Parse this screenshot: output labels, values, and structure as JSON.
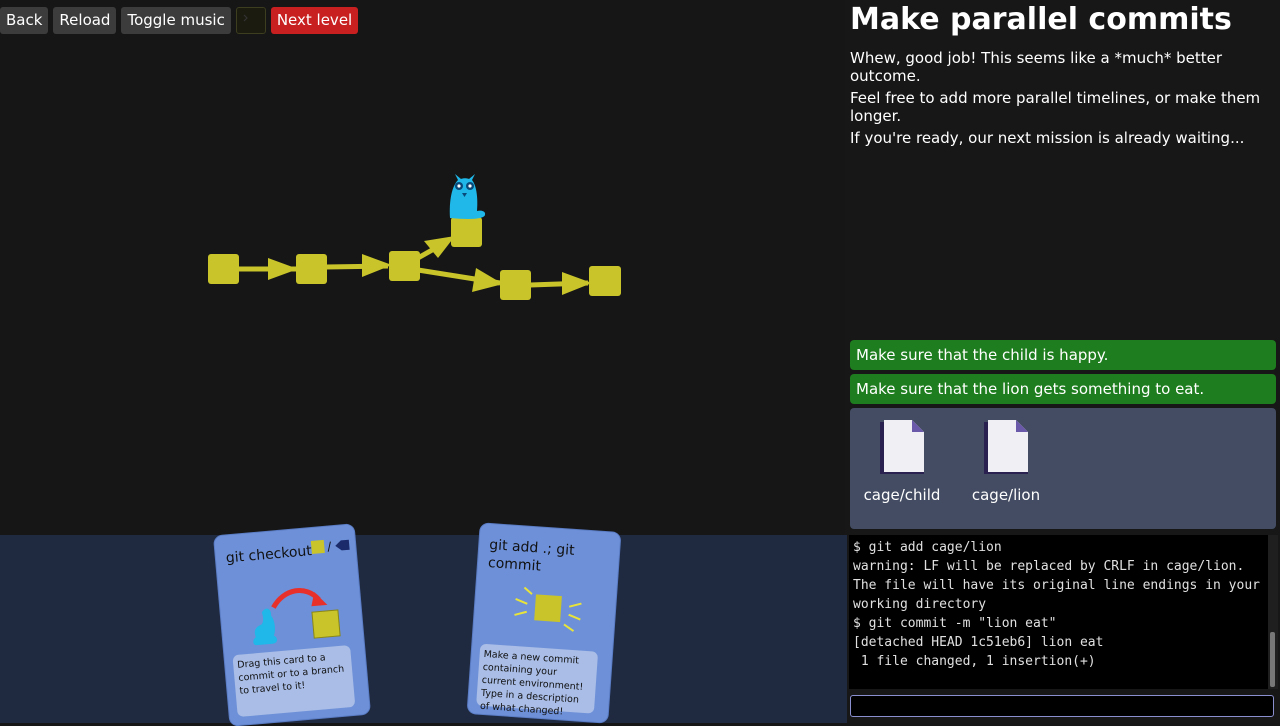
{
  "toolbar": {
    "back_label": "Back",
    "reload_label": "Reload",
    "toggle_music_label": "Toggle music",
    "next_level_label": "Next level",
    "next_level_color": "#c82020"
  },
  "level": {
    "title": "Make parallel commits",
    "paragraphs": [
      "Whew, good job! This seems like a *much* better outcome.",
      "Feel free to add more parallel timelines, or make them longer.",
      "If you're ready, our next mission is already waiting..."
    ]
  },
  "goals": [
    {
      "label": "Make sure that the child is happy.",
      "status": "done"
    },
    {
      "label": "Make sure that the lion gets something to eat.",
      "status": "done"
    }
  ],
  "files": [
    {
      "name": "cage/child",
      "icon": "file-icon"
    },
    {
      "name": "cage/lion",
      "icon": "file-icon"
    }
  ],
  "terminal": {
    "lines": [
      "$ git add cage/lion",
      "warning: LF will be replaced by CRLF in cage/lion.",
      "The file will have its original line endings in your",
      "working directory",
      "$ git commit -m \"lion eat\"",
      "[detached HEAD 1c51eb6] lion eat",
      " 1 file changed, 1 insertion(+)"
    ],
    "input_value": ""
  },
  "cards": [
    {
      "title": "git checkout",
      "description": "Drag this card to a commit or to a branch to travel to it!",
      "icon": "checkout-icon"
    },
    {
      "title": "git add .; git commit",
      "description": "Make a new commit containing your current environment! Type in a description of what changed!",
      "icon": "commit-icon"
    }
  ],
  "graph": {
    "commit_color": "#c8c42a",
    "head_icon": "owl-icon",
    "commits": [
      "c1",
      "c2",
      "c3",
      "c4",
      "c5",
      "c6"
    ],
    "edges": [
      [
        "c1",
        "c2"
      ],
      [
        "c2",
        "c3"
      ],
      [
        "c3",
        "c4"
      ],
      [
        "c3",
        "c5"
      ],
      [
        "c5",
        "c6"
      ]
    ],
    "head_commit": "c4"
  }
}
